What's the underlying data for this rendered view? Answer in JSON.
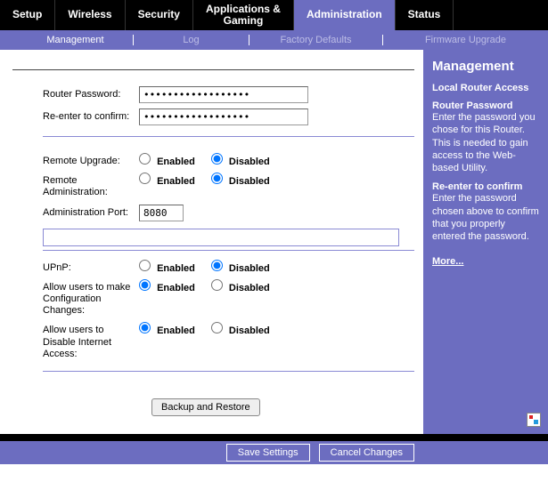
{
  "topnav": {
    "items": [
      {
        "label": "Setup"
      },
      {
        "label": "Wireless"
      },
      {
        "label": "Security"
      },
      {
        "label": "Applications &\nGaming"
      },
      {
        "label": "Administration"
      },
      {
        "label": "Status"
      }
    ]
  },
  "subnav": {
    "items": [
      {
        "label": "Management"
      },
      {
        "label": "Log"
      },
      {
        "label": "Factory Defaults"
      },
      {
        "label": "Firmware Upgrade"
      }
    ]
  },
  "form": {
    "router_password_label": "Router Password:",
    "router_password_value": "••••••••••••••••••",
    "reenter_label": "Re-enter to confirm:",
    "reenter_value": "••••••••••••••••••",
    "remote_upgrade_label": "Remote Upgrade:",
    "remote_admin_label": "Remote Administration:",
    "admin_port_label": "Administration Port:",
    "admin_port_value": "8080",
    "upnp_label": "UPnP:",
    "allow_config_label": "Allow users to make Configuration Changes:",
    "allow_disable_label": "Allow users to Disable Internet Access:",
    "enabled": "Enabled",
    "disabled": "Disabled",
    "backup_btn": "Backup and Restore"
  },
  "footer": {
    "save": "Save Settings",
    "cancel": "Cancel Changes"
  },
  "side": {
    "title": "Management",
    "section1_title": "Local Router Access",
    "rp_title": "Router Password",
    "rp_text": "Enter the password you chose for this Router. This is needed to gain access to the Web-based Utility.",
    "re_title": "Re-enter to confirm",
    "re_text": "Enter the password chosen above to confirm that you properly entered the password.",
    "more": "More..."
  }
}
